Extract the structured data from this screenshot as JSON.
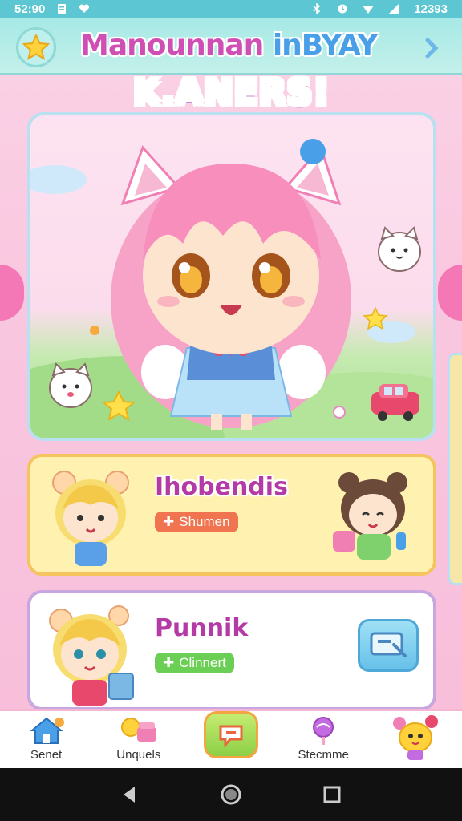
{
  "status_bar": {
    "time": "52:90",
    "battery_text": "12393"
  },
  "header": {
    "title_part1": "Manounnan ",
    "title_part2": "inBYAY",
    "subtitle": "K.ANERS!"
  },
  "cards": [
    {
      "title": "Ihobendis",
      "tag": "Shumen",
      "tag_color": "#f0744f"
    },
    {
      "title": "Punnik",
      "tag": "Clinnert",
      "tag_color": "#6ccf55"
    }
  ],
  "bottom_nav": {
    "items": [
      {
        "label": "Senet",
        "icon": "home-icon"
      },
      {
        "label": "Unquels",
        "icon": "treats-icon"
      },
      {
        "label": "",
        "icon": "chat-bubble-icon"
      },
      {
        "label": "Stecmme",
        "icon": "lollipop-icon"
      },
      {
        "label": "",
        "icon": "mascot-icon"
      }
    ]
  },
  "colors": {
    "accent_pink": "#f477b6",
    "header_teal": "#a6e9e6",
    "status_bar": "#5cc7d2"
  }
}
